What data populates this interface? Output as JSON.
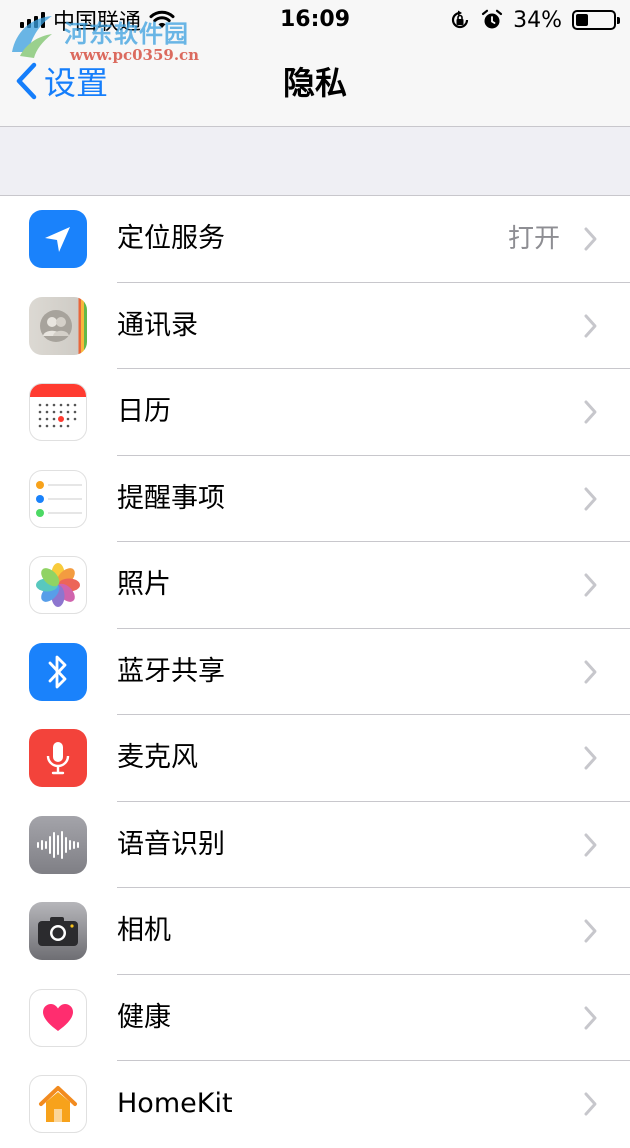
{
  "status": {
    "carrier": "中国联通",
    "time": "16:09",
    "battery": "34%",
    "battery_level": 0.34
  },
  "watermark": {
    "title": "河东软件园",
    "url": "www.pc0359.cn"
  },
  "nav": {
    "back": "设置",
    "title": "隐私"
  },
  "items": [
    {
      "label": "定位服务",
      "value": "打开",
      "icon": "location-arrow-icon",
      "color": "#1a82fb"
    },
    {
      "label": "通讯录",
      "value": "",
      "icon": "contacts-icon",
      "color": "#d9d6d0"
    },
    {
      "label": "日历",
      "value": "",
      "icon": "calendar-icon",
      "color": "#ff3b30"
    },
    {
      "label": "提醒事项",
      "value": "",
      "icon": "reminders-icon",
      "color": "#ffffff"
    },
    {
      "label": "照片",
      "value": "",
      "icon": "photos-icon",
      "color": "#ffffff"
    },
    {
      "label": "蓝牙共享",
      "value": "",
      "icon": "bluetooth-icon",
      "color": "#1a82fb"
    },
    {
      "label": "麦克风",
      "value": "",
      "icon": "microphone-icon",
      "color": "#f3433b"
    },
    {
      "label": "语音识别",
      "value": "",
      "icon": "speech-waveform-icon",
      "color": "#8e8e93"
    },
    {
      "label": "相机",
      "value": "",
      "icon": "camera-icon",
      "color": "#8a8a8e"
    },
    {
      "label": "健康",
      "value": "",
      "icon": "heart-icon",
      "color": "#ff2d55"
    },
    {
      "label": "HomeKit",
      "value": "",
      "icon": "home-icon",
      "color": "#f7a21b"
    }
  ]
}
